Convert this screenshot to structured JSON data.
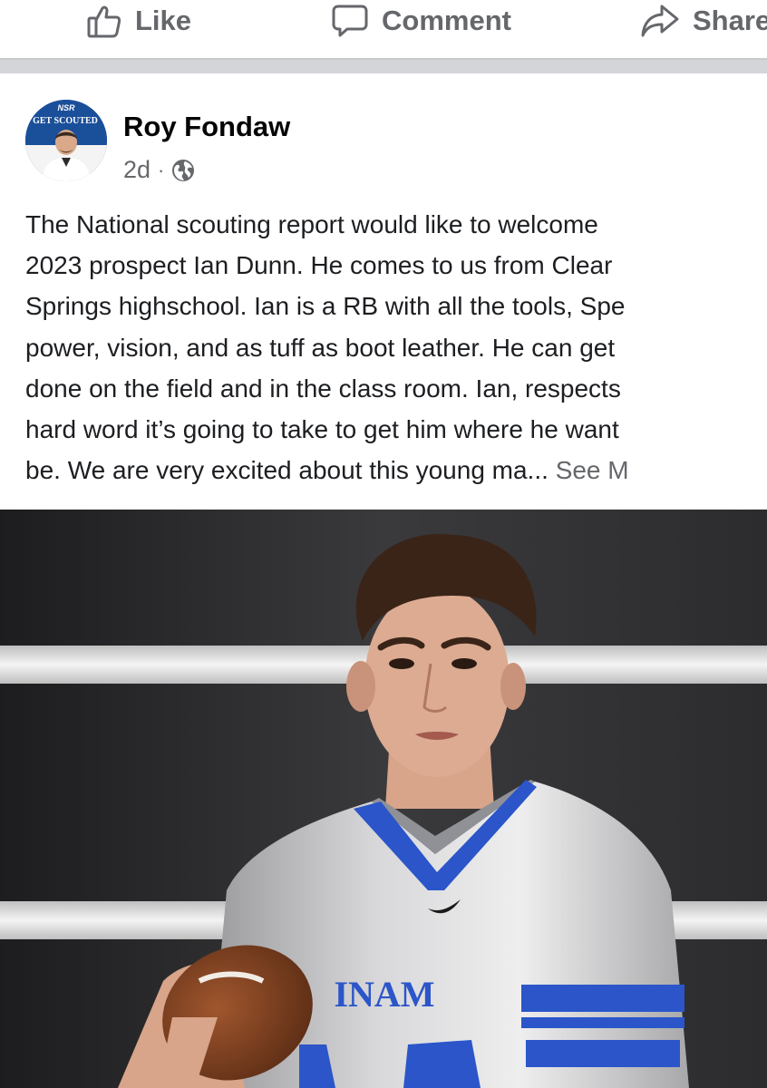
{
  "actions": {
    "like_label": "Like",
    "comment_label": "Comment",
    "share_label": "Share"
  },
  "post": {
    "author": "Roy Fondaw",
    "avatar_text": {
      "top": "NSR",
      "banner": "GET SCOUTED"
    },
    "time": "2d",
    "separator": "·",
    "audience_icon": "globe-icon",
    "text_lines": [
      "The National scouting report would like to welcome",
      "2023 prospect Ian Dunn. He comes to us from Clear",
      "Springs highschool. Ian is a RB with all the tools, Spe",
      "power, vision, and as tuff as boot leather. He can get",
      "done on the field and in the class room. Ian, respects",
      "hard word it’s going to take to get him where he want",
      "be. We are very excited about this young ma..."
    ],
    "see_more": "See M"
  },
  "photo": {
    "jersey_text": "INAM"
  },
  "colors": {
    "action_gray": "#65676b",
    "divider": "#d3d5d9",
    "jersey_blue": "#2b55c9",
    "avatar_blue": "#1d5fae"
  }
}
